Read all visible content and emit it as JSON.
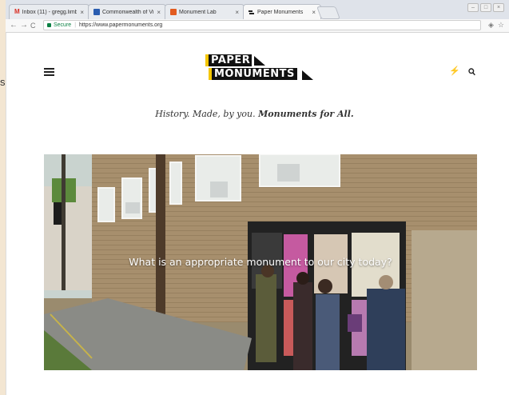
{
  "browser": {
    "tabs": [
      {
        "title": "Inbox (11) - gregg.limb",
        "favicon_color": "#d93025",
        "favicon_letter": "M"
      },
      {
        "title": "Commonwealth of Virgi",
        "favicon_color": "#2a5db0",
        "favicon_letter": ""
      },
      {
        "title": "Monument Lab",
        "favicon_color": "#e25b1f",
        "favicon_letter": ""
      },
      {
        "title": "Paper Monuments",
        "favicon_color": "#222222",
        "favicon_letter": ""
      }
    ],
    "close_glyph": "×",
    "address": {
      "secure_label": "Secure",
      "url": "https://www.papermonuments.org"
    }
  },
  "page": {
    "logo_line1": "PAPER",
    "logo_line2": "MONUMENTS",
    "tagline_plain": "History. Made, by you.",
    "tagline_bold": "Monuments for All.",
    "hero_caption": "What is an appropriate monument to our city today?"
  },
  "colors": {
    "accent_yellow": "#f5c600",
    "secure_green": "#0b8043"
  },
  "icons": [
    "menu-icon",
    "bolt-icon",
    "search-icon",
    "back-icon",
    "forward-icon",
    "reload-icon",
    "star-icon"
  ]
}
